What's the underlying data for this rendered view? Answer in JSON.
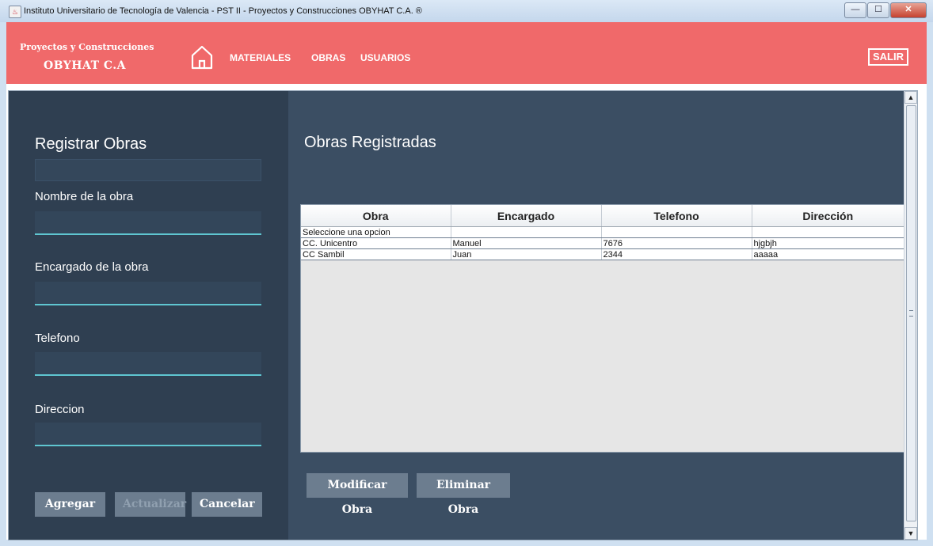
{
  "window": {
    "title": "Instituto Universitario de Tecnología de Valencia - PST II - Proyectos y Construcciones OBYHAT C.A. ®",
    "controls": {
      "minimize": "—",
      "maximize": "☐",
      "close": "✕"
    }
  },
  "header": {
    "brand_line1": "Proyectos y Construcciones",
    "brand_line2": "OBYHAT C.A",
    "nav": [
      "MATERIALES",
      "OBRAS",
      "USUARIOS"
    ],
    "exit": "SALIR",
    "colors": {
      "bar": "#f0696a",
      "text": "#ffffff"
    }
  },
  "form": {
    "title": "Registrar Obras",
    "fields": {
      "nombre": {
        "label": "Nombre de la obra",
        "value": ""
      },
      "encargado": {
        "label": "Encargado de la obra",
        "value": ""
      },
      "telefono": {
        "label": "Telefono",
        "value": ""
      },
      "direccion": {
        "label": "Direccion",
        "value": ""
      }
    },
    "buttons": {
      "add": "Agregar",
      "update": "Actualizar",
      "cancel": "Cancelar"
    },
    "colors": {
      "panel": "#2f3f51",
      "underline": "#5fc6d1"
    }
  },
  "list": {
    "title": "Obras Registradas",
    "columns": [
      "Obra",
      "Encargado",
      "Telefono",
      "Dirección"
    ],
    "rows": [
      [
        "Seleccione una opcion",
        "",
        "",
        ""
      ],
      [
        "CC. Unicentro",
        "Manuel",
        "7676",
        "hjgbjh"
      ],
      [
        "CC Sambil",
        "Juan",
        "2344",
        "aaaaa"
      ]
    ],
    "buttons": {
      "modify": "Modificar Obra",
      "delete": "Eliminar Obra"
    }
  },
  "scrollbar": {
    "up": "▲",
    "down": "▼"
  }
}
